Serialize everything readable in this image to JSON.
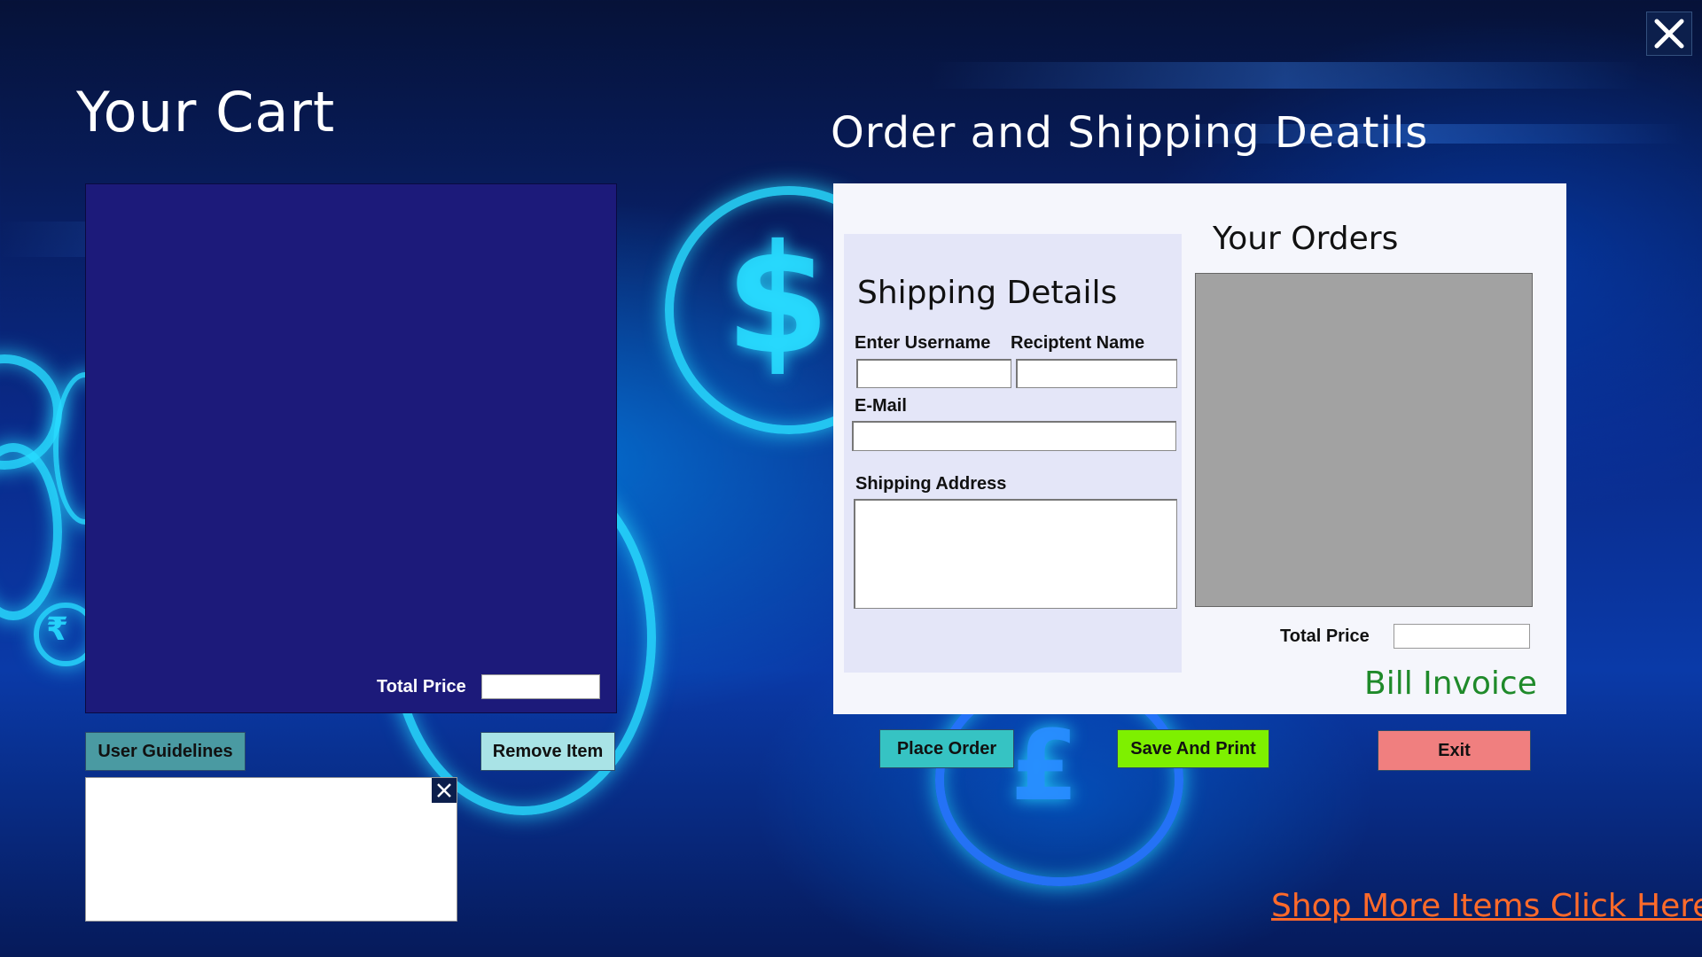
{
  "window": {
    "close_icon": "close-x-icon"
  },
  "cart": {
    "title": "Your Cart",
    "total_price_label": "Total Price",
    "total_price_value": "",
    "buttons": {
      "user_guidelines": "User Guidelines",
      "remove_item": "Remove Item"
    },
    "guidelines_box": {
      "text": "",
      "close_icon": "close-x-icon"
    }
  },
  "order": {
    "title": "Order and Shipping Deatils",
    "shipping": {
      "title": "Shipping Details",
      "username_label": "Enter Username",
      "username_value": "",
      "recipient_label": "Reciptent Name",
      "recipient_value": "",
      "email_label": "E-Mail",
      "email_value": "",
      "address_label": "Shipping Address",
      "address_value": ""
    },
    "orders": {
      "title": "Your Orders",
      "total_price_label": "Total Price",
      "total_price_value": ""
    },
    "bill_invoice": "Bill Invoice",
    "buttons": {
      "place_order": "Place Order",
      "save_print": "Save And Print",
      "exit": "Exit"
    }
  },
  "footer": {
    "shop_more_link": "Shop More Items Click Here"
  },
  "colors": {
    "cart_panel": "#1c1a7a",
    "user_guidelines_button": "#4a9aa2",
    "remove_item_button": "#a9e3e6",
    "place_order_button": "#36c3c3",
    "save_print_button": "#7ef000",
    "exit_button": "#f07f7f",
    "bill_invoice_text": "#1f8a2a",
    "shop_more_link": "#ff6a2a"
  }
}
